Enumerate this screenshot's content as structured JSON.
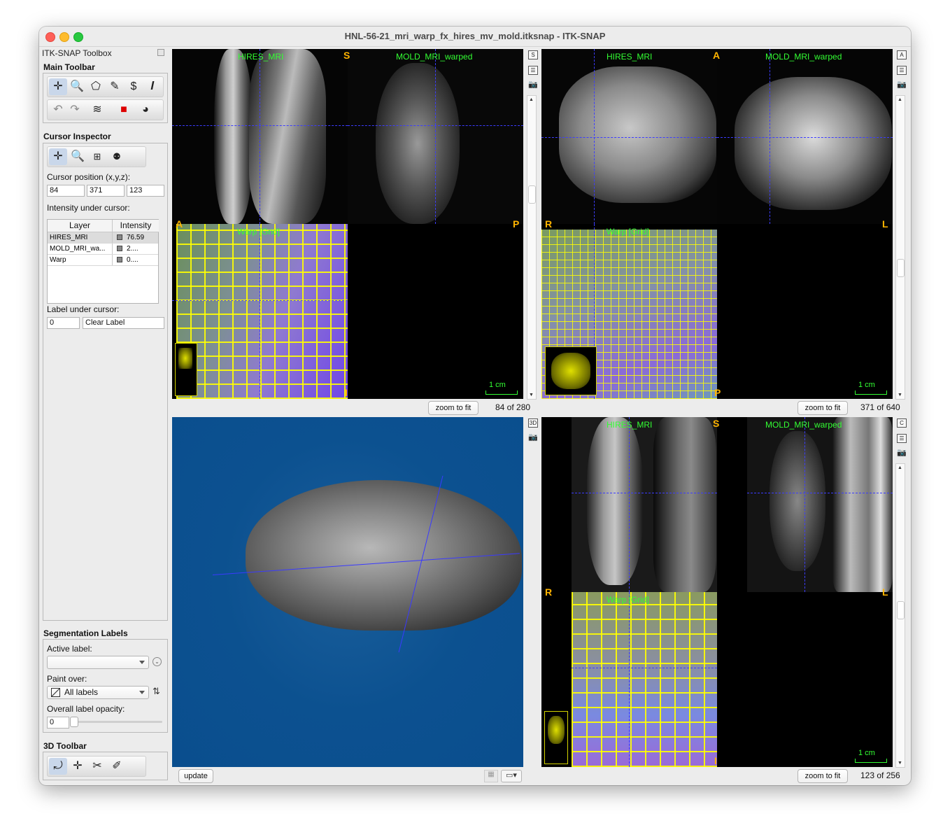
{
  "window": {
    "title": "HNL-56-21_mri_warp_fx_hires_mv_mold.itksnap - ITK-SNAP"
  },
  "toolbox": {
    "title": "ITK-SNAP Toolbox",
    "main_toolbar": {
      "title": "Main Toolbar",
      "tools": [
        "crosshair-icon",
        "zoom-icon",
        "polygon-icon",
        "paintbrush-icon",
        "snake-icon",
        "annotation-icon"
      ],
      "actions": [
        "undo-icon",
        "redo-icon",
        "layers-icon",
        "label-color-icon",
        "palette-icon"
      ]
    },
    "cursor_inspector": {
      "title": "Cursor Inspector",
      "position_label": "Cursor position (x,y,z):",
      "x": "84",
      "y": "371",
      "z": "123",
      "intensity_label": "Intensity under cursor:",
      "columns": [
        "Layer",
        "Intensity"
      ],
      "rows": [
        {
          "layer": "HIRES_MRI",
          "value": "76.59"
        },
        {
          "layer": "MOLD_MRI_wa...",
          "value": "2...."
        },
        {
          "layer": "Warp",
          "value": "0...."
        }
      ],
      "label_under_cursor_label": "Label under cursor:",
      "label_id": "0",
      "label_name": "Clear Label"
    },
    "segmentation": {
      "title": "Segmentation Labels",
      "active_label": "Active label:",
      "active_value": "",
      "paint_over": "Paint over:",
      "paint_over_value": "All labels",
      "opacity_label": "Overall label opacity:",
      "opacity_value": "0"
    },
    "toolbar_3d": {
      "title": "3D Toolbar"
    }
  },
  "views": {
    "sagittal": {
      "layer_a": "HIRES_MRI",
      "layer_b": "MOLD_MRI_warped",
      "warp": "Warp [Grid]",
      "o_top": "S",
      "o_left": "A",
      "o_right": "P",
      "o_bottom": "I",
      "scale": "1 cm",
      "zoom_btn": "zoom to fit",
      "slice": "84 of 280",
      "side_tool": "S"
    },
    "axial": {
      "layer_a": "HIRES_MRI",
      "layer_b": "MOLD_MRI_warped",
      "warp": "Warp [Grid]",
      "o_top": "A",
      "o_left": "R",
      "o_right": "L",
      "o_bottom": "P",
      "scale": "1 cm",
      "zoom_btn": "zoom to fit",
      "slice": "371 of 640",
      "side_tool": "A"
    },
    "render3d": {
      "update_btn": "update",
      "side_tool": "3D"
    },
    "coronal": {
      "layer_a": "HIRES_MRI",
      "layer_b": "MOLD_MRI_warped",
      "warp": "Warp [Grid]",
      "o_top": "S",
      "o_left": "R",
      "o_right": "L",
      "o_bottom": "I",
      "scale": "1 cm",
      "zoom_btn": "zoom to fit",
      "slice": "123 of 256",
      "side_tool": "C"
    }
  },
  "colors": {
    "overlay_text": "#33ff33",
    "orientation": "#ffb400",
    "crosshair": "#3c3cff",
    "render_bg": "#0a4e8e"
  }
}
